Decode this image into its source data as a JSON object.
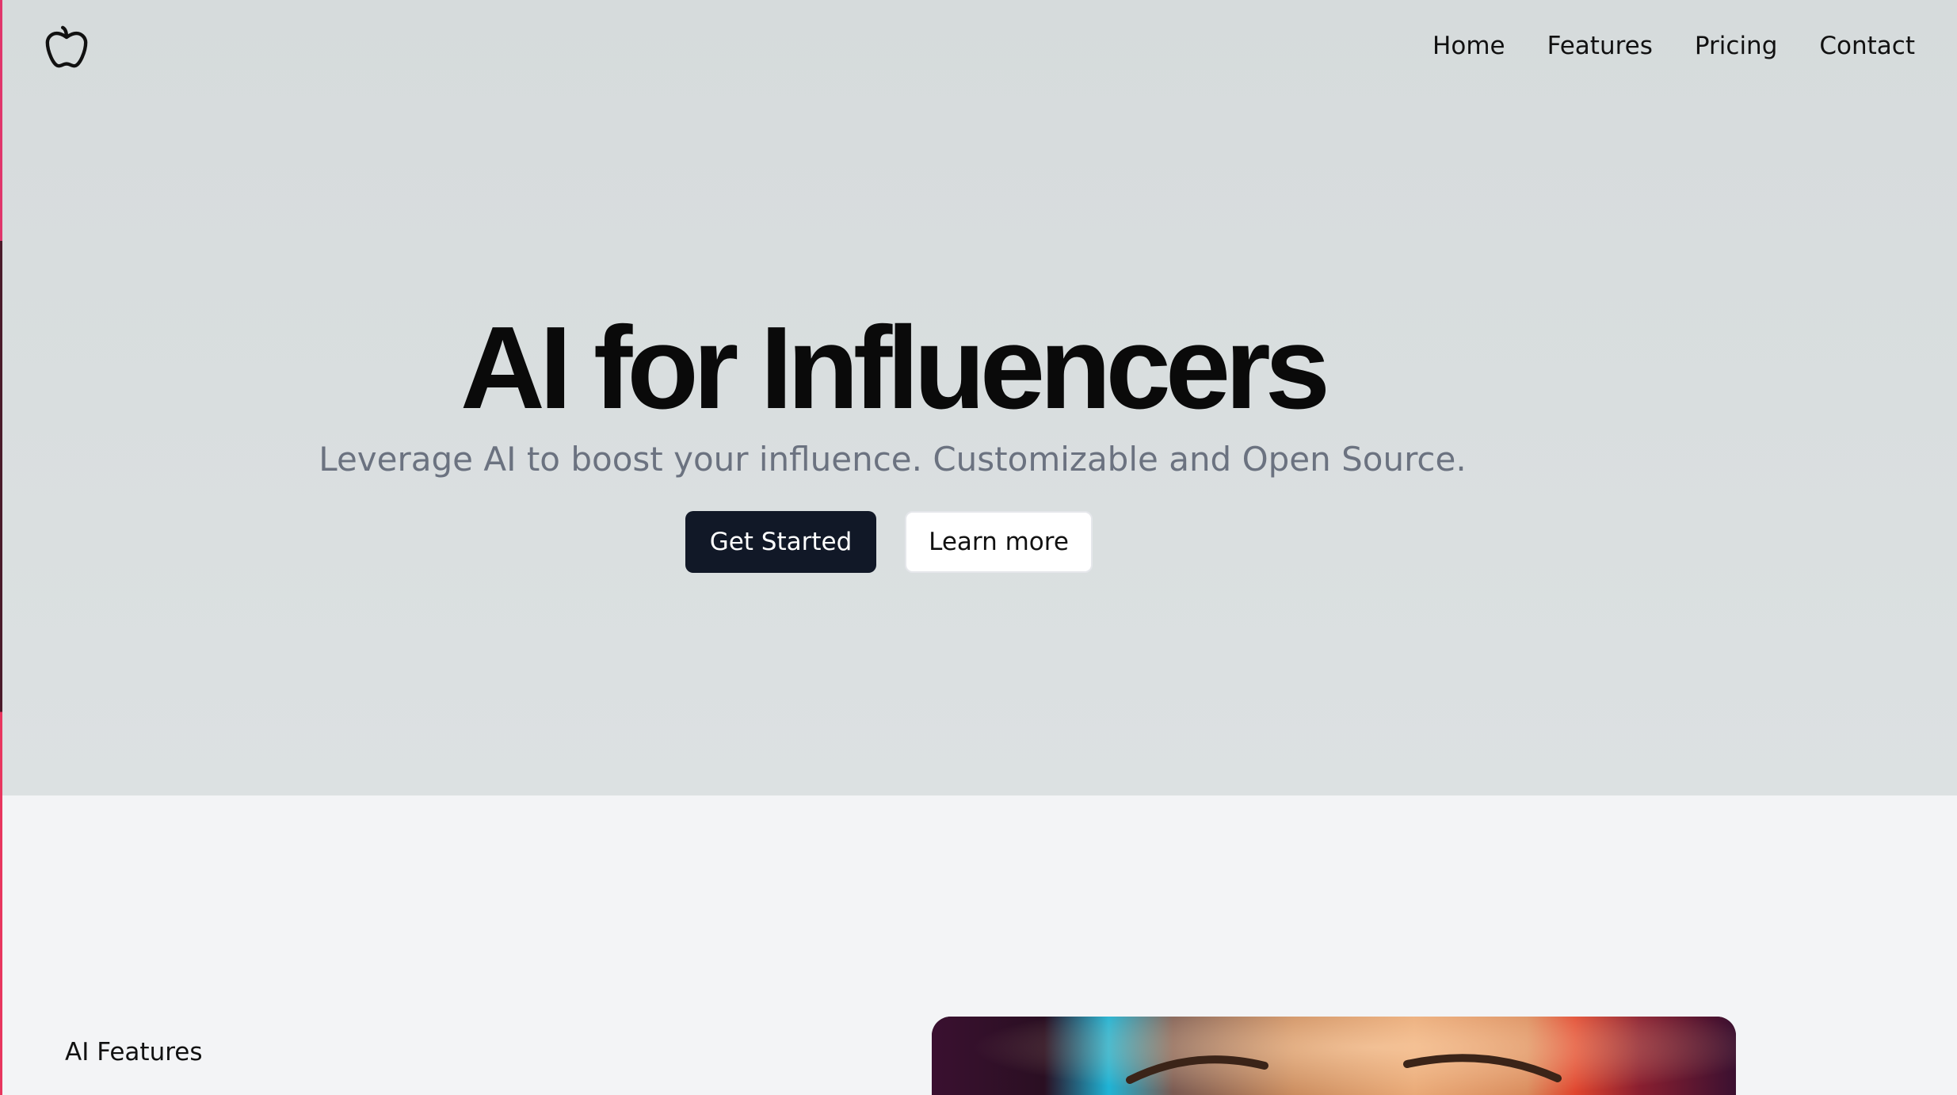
{
  "nav": {
    "logo_icon": "apple-icon",
    "links": [
      "Home",
      "Features",
      "Pricing",
      "Contact"
    ]
  },
  "hero": {
    "title": "AI for Influencers",
    "subtitle": "Leverage AI to boost your influence. Customizable and Open Source.",
    "primary_button": "Get Started",
    "secondary_button": "Learn more"
  },
  "features": {
    "label": "AI Features"
  },
  "colors": {
    "hero_background": "#d9dedf",
    "page_background": "#f3f4f6",
    "primary_button": "#111827",
    "subtitle": "#6b7280"
  }
}
